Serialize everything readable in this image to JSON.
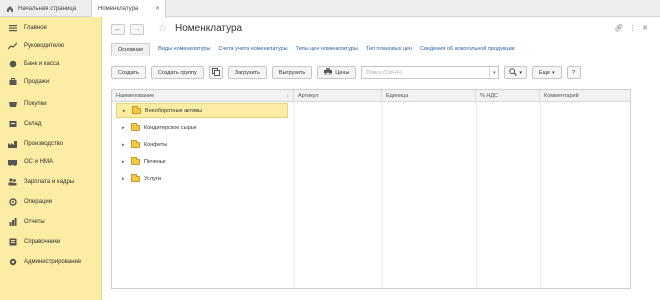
{
  "tabs": {
    "home": "Начальная страница",
    "active": "Номенклатура"
  },
  "sidebar": {
    "items": [
      {
        "label": "Главное",
        "icon": "menu-icon"
      },
      {
        "label": "Руководителю",
        "icon": "trend-icon"
      },
      {
        "label": "Банк и касса",
        "icon": "coins-icon"
      },
      {
        "label": "Продажи",
        "icon": "cart-icon"
      },
      {
        "label": "Покупки",
        "icon": "basket-icon"
      },
      {
        "label": "Склад",
        "icon": "warehouse-icon"
      },
      {
        "label": "Производство",
        "icon": "factory-icon"
      },
      {
        "label": "ОС и НМА",
        "icon": "assets-icon"
      },
      {
        "label": "Зарплата и кадры",
        "icon": "people-icon"
      },
      {
        "label": "Операции",
        "icon": "operations-icon"
      },
      {
        "label": "Отчеты",
        "icon": "chart-icon"
      },
      {
        "label": "Справочники",
        "icon": "book-icon"
      },
      {
        "label": "Администрирование",
        "icon": "gear-icon"
      }
    ]
  },
  "header": {
    "title": "Номенклатура",
    "back": "←",
    "forward": "→"
  },
  "links": {
    "main": "Основная",
    "items": [
      "Виды номенклатуры",
      "Счета учета номенклатуры",
      "Типы цен номенклатуры",
      "Тип плановых цен",
      "Сведения об алкогольной продукции"
    ]
  },
  "toolbar": {
    "create": "Создать",
    "create_group": "Создать группу",
    "upload": "Загрузить",
    "download": "Выгрузить",
    "prices": "Цены",
    "search_placeholder": "Поиск (Ctrl+F)",
    "more": "Еще",
    "help": "?"
  },
  "table": {
    "columns": [
      "Наименование",
      "Артикул",
      "Единица",
      "% НДС",
      "Комментарий"
    ],
    "rows": [
      {
        "name": "Внеоборотные активы",
        "selected": true
      },
      {
        "name": "Кондитерское сырье",
        "selected": false
      },
      {
        "name": "Конфеты",
        "selected": false
      },
      {
        "name": "Печенье",
        "selected": false
      },
      {
        "name": "Услуги",
        "selected": false
      }
    ]
  }
}
